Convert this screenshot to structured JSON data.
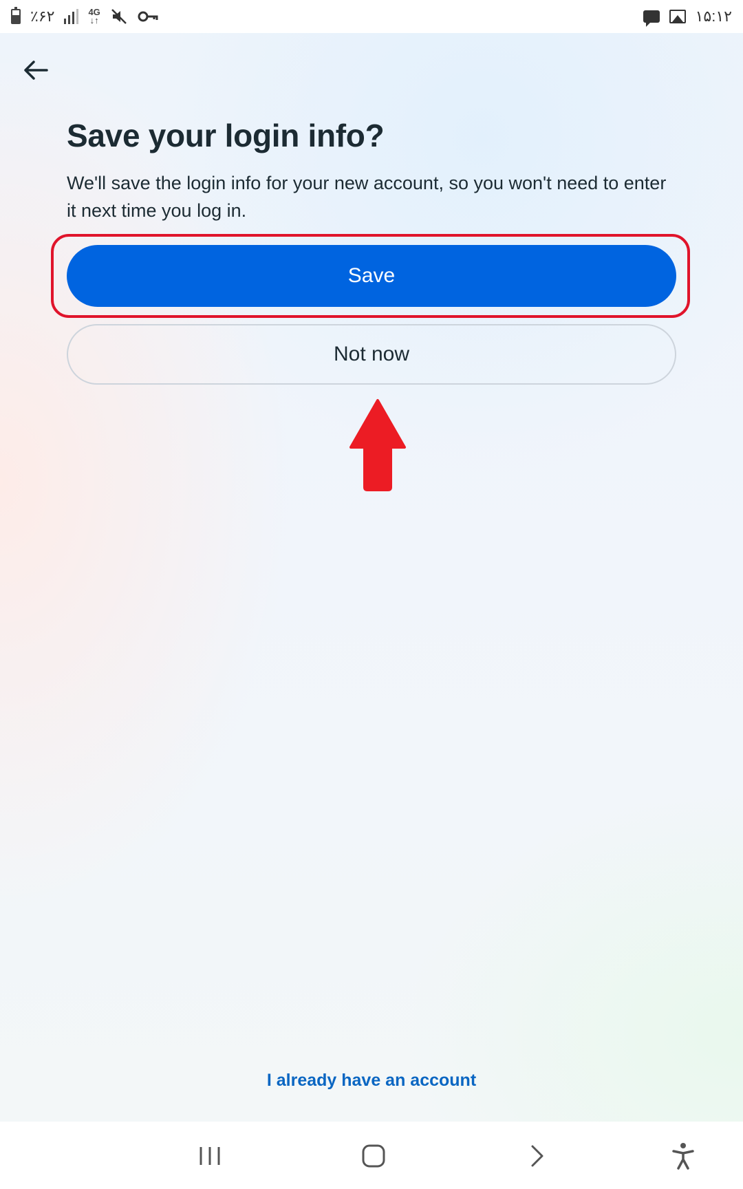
{
  "status_bar": {
    "battery": "٪۶۲",
    "network": "4G",
    "time": "۱۵:۱۲"
  },
  "page": {
    "title": "Save your login info?",
    "description": "We'll save the login info for your new account, so you won't need to enter it next time you log in.",
    "save_label": "Save",
    "not_now_label": "Not now",
    "already_account_label": "I already have an account"
  },
  "colors": {
    "primary": "#0064e0",
    "highlight": "#e0142b",
    "link": "#0a66c2",
    "text": "#1c2b33"
  },
  "icons": {
    "back": "arrow-left-icon",
    "nav_recents": "recents-icon",
    "nav_home": "home-icon",
    "nav_back": "chevron-right-icon",
    "nav_accessibility": "accessibility-icon"
  }
}
